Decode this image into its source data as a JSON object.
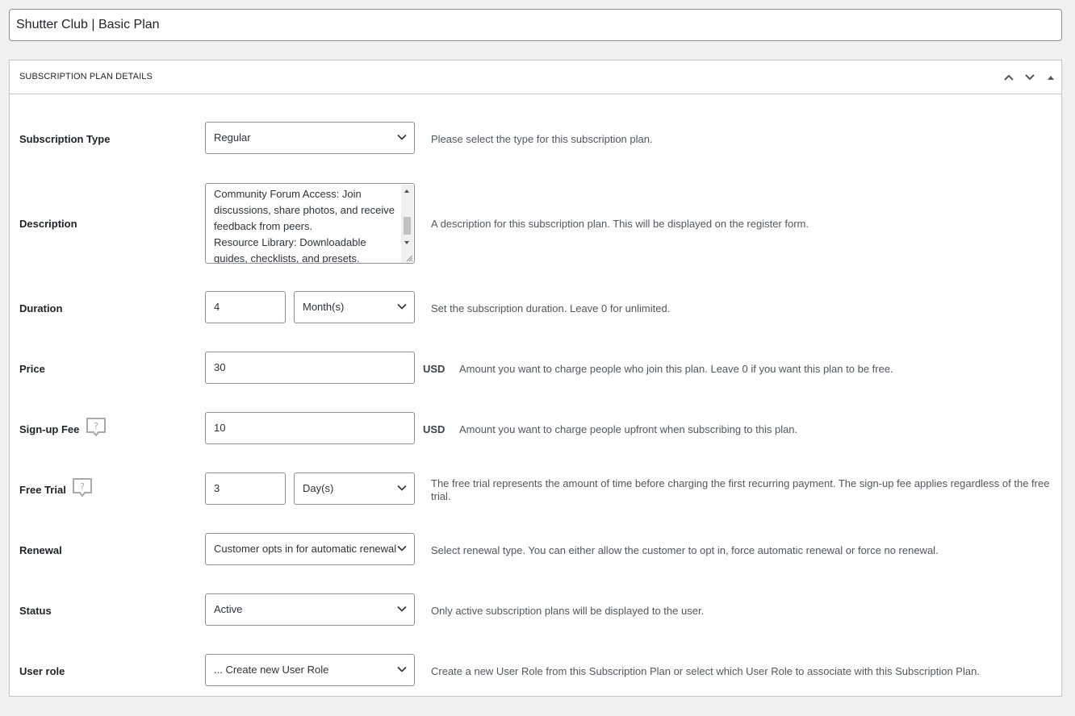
{
  "title_input": {
    "value": "Shutter Club | Basic Plan"
  },
  "panel": {
    "title": "SUBSCRIPTION PLAN DETAILS",
    "controls": [
      "chevron-up-icon",
      "chevron-down-icon",
      "triangle-up-icon"
    ]
  },
  "fields": {
    "subscription_type": {
      "label": "Subscription Type",
      "value": "Regular",
      "description": "Please select the type for this subscription plan."
    },
    "description": {
      "label": "Description",
      "lines": [
        "Community Forum Access: Join",
        "discussions, share photos, and receive",
        "feedback from peers.",
        "Resource Library: Downloadable",
        "guides, checklists, and presets."
      ],
      "description": "A description for this subscription plan. This will be displayed on the register form."
    },
    "duration": {
      "label": "Duration",
      "value": "4",
      "unit": "Month(s)",
      "description": "Set the subscription duration. Leave 0 for unlimited."
    },
    "price": {
      "label": "Price",
      "value": "30",
      "currency": "USD",
      "description": "Amount you want to charge people who join this plan. Leave 0 if you want this plan to be free."
    },
    "signup_fee": {
      "label": "Sign-up Fee",
      "value": "10",
      "currency": "USD",
      "description": "Amount you want to charge people upfront when subscribing to this plan."
    },
    "free_trial": {
      "label": "Free Trial",
      "value": "3",
      "unit": "Day(s)",
      "description_line1": "The free trial represents the amount of time before charging the first recurring payment. The sign-up fee applies regardless of the free",
      "description_line2": "trial."
    },
    "renewal": {
      "label": "Renewal",
      "value": "Customer opts in for automatic renewal",
      "description": "Select renewal type. You can either allow the customer to opt in, force automatic renewal or force no renewal."
    },
    "status": {
      "label": "Status",
      "value": "Active",
      "description": "Only active subscription plans will be displayed to the user."
    },
    "user_role": {
      "label": "User role",
      "value": "... Create new User Role",
      "description": "Create a new User Role from this Subscription Plan or select which User Role to associate with this Subscription Plan."
    }
  },
  "colors": {
    "background": "#f0f0f1",
    "panel_border": "#c3c4c7",
    "input_border": "#8c8f94",
    "help_text": "#50575e"
  }
}
